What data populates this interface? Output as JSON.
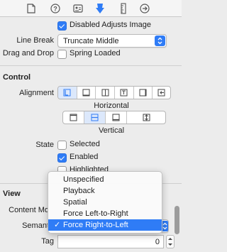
{
  "toolbar": {
    "icons": [
      "file-icon",
      "help-icon",
      "identity-icon",
      "attributes-icon",
      "size-ruler-icon",
      "connections-arrow-icon"
    ]
  },
  "text_attrs": {
    "disabled_adjusts_image": "Disabled Adjusts Image",
    "line_break_label": "Line Break",
    "line_break_value": "Truncate Middle",
    "drag_and_drop_label": "Drag and Drop",
    "spring_loaded": "Spring Loaded"
  },
  "control": {
    "title": "Control",
    "alignment_label": "Alignment",
    "horizontal_caption": "Horizontal",
    "vertical_caption": "Vertical",
    "state_label": "State",
    "selected": "Selected",
    "enabled": "Enabled",
    "highlighted": "Highlighted"
  },
  "view": {
    "title": "View",
    "content_mode_label": "Content Mo",
    "semantic_label": "Semant",
    "tag_label": "Tag",
    "tag_value": "0"
  },
  "semantic_menu": {
    "items": [
      "Unspecified",
      "Playback",
      "Spatial",
      "Force Left-to-Right",
      "Force Right-to-Left"
    ],
    "selected": "Force Right-to-Left"
  },
  "colors": {
    "accent": "#2f7cf6",
    "panel": "#ececec"
  }
}
